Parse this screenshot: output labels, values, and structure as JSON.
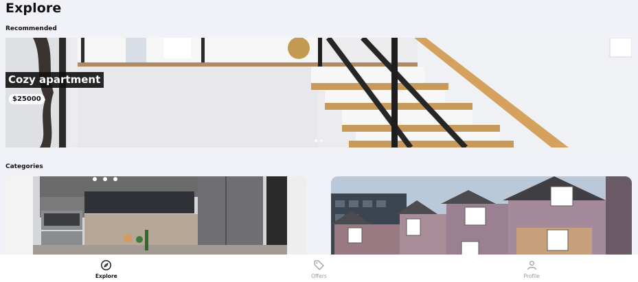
{
  "header": {
    "title": "Explore"
  },
  "sections": {
    "recommended": "Recommended",
    "categories": "Categories"
  },
  "recommended": {
    "title": "Cozy apartment",
    "price": "$25000",
    "carousel": {
      "pages": 2,
      "active": 1
    }
  },
  "categories": [
    {
      "name": "kitchen-interior"
    },
    {
      "name": "townhouses-exterior"
    }
  ],
  "nav": {
    "items": [
      {
        "label": "Explore",
        "icon": "compass-icon",
        "active": true
      },
      {
        "label": "Offers",
        "icon": "tag-icon",
        "active": false
      },
      {
        "label": "Profile",
        "icon": "user-icon",
        "active": false
      }
    ]
  },
  "colors": {
    "background": "#f1f2f7",
    "active": "#111111",
    "inactive": "#9a9a9f",
    "stair_wood": "#c89a5a"
  }
}
